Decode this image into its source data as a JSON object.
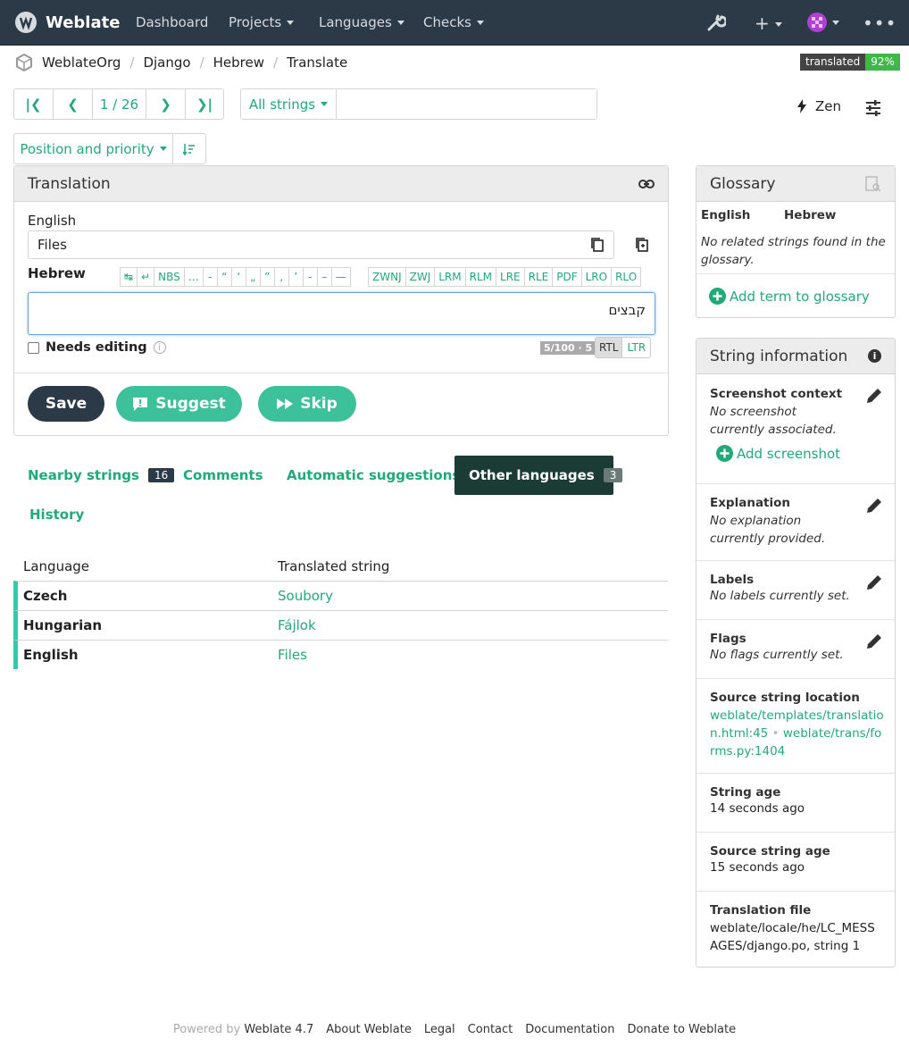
{
  "navbar": {
    "brand": "Weblate",
    "items": [
      "Dashboard",
      "Projects",
      "Languages",
      "Checks"
    ]
  },
  "breadcrumb": [
    "WeblateOrg",
    "Django",
    "Hebrew",
    "Translate"
  ],
  "stat_badge": {
    "label": "translated",
    "value": "92%"
  },
  "pager": {
    "position": "1 / 26"
  },
  "filter": {
    "label": "All strings",
    "search_value": ""
  },
  "zen": "Zen",
  "sort": {
    "label": "Position and priority"
  },
  "translation_panel": {
    "title": "Translation",
    "source_lang": "English",
    "source_text": "Files",
    "target_lang": "Hebrew",
    "special_chars": [
      "↹",
      "↵",
      "NBS",
      "…",
      "-",
      "“",
      "‘",
      "„",
      "”",
      ",",
      "’",
      "-",
      "–",
      "—"
    ],
    "bidi_chars": [
      "ZWNJ",
      "ZWJ",
      "LRM",
      "RLM",
      "LRE",
      "RLE",
      "PDF",
      "LRO",
      "RLO"
    ],
    "target_text": "קבצים",
    "needs_editing": "Needs editing",
    "length_counter": "5/100 · 5",
    "dir_rtl": "RTL",
    "dir_ltr": "LTR",
    "save": "Save",
    "suggest": "Suggest",
    "skip": "Skip"
  },
  "tabs": {
    "nearby": "Nearby strings",
    "nearby_count": "16",
    "comments": "Comments",
    "automatic": "Automatic suggestions",
    "other": "Other languages",
    "other_count": "3",
    "history": "History"
  },
  "other_languages": {
    "headers": [
      "Language",
      "Translated string"
    ],
    "rows": [
      {
        "language": "Czech",
        "text": "Soubory"
      },
      {
        "language": "Hungarian",
        "text": "Fájlok"
      },
      {
        "language": "English",
        "text": "Files"
      }
    ]
  },
  "glossary": {
    "title": "Glossary",
    "col_source": "English",
    "col_target": "Hebrew",
    "empty": "No related strings found in the glossary.",
    "add": "Add term to glossary"
  },
  "string_info": {
    "title": "String information",
    "screenshot_label": "Screenshot context",
    "screenshot_value": "No screenshot currently associated.",
    "add_screenshot": "Add screenshot",
    "explanation_label": "Explanation",
    "explanation_value": "No explanation currently provided.",
    "labels_label": "Labels",
    "labels_value": "No labels currently set.",
    "flags_label": "Flags",
    "flags_value": "No flags currently set.",
    "location_label": "Source string location",
    "location_1": "weblate/templates/translation.html:45",
    "location_sep": "•",
    "location_2": "weblate/trans/forms.py:1404",
    "age_label": "String age",
    "age_value": "14 seconds ago",
    "source_age_label": "Source string age",
    "source_age_value": "15 seconds ago",
    "file_label": "Translation file",
    "file_value": "weblate/locale/he/LC_MESSAGES/django.po, string 1"
  },
  "footer": {
    "powered": "Powered by",
    "version": "Weblate 4.7",
    "links": [
      "About Weblate",
      "Legal",
      "Contact",
      "Documentation",
      "Donate to Weblate"
    ]
  },
  "colors": {
    "navbar": "#2c3a47",
    "accent": "#22a97a",
    "dark_button": "#2c3a47",
    "active_tab": "#1b3b35"
  }
}
